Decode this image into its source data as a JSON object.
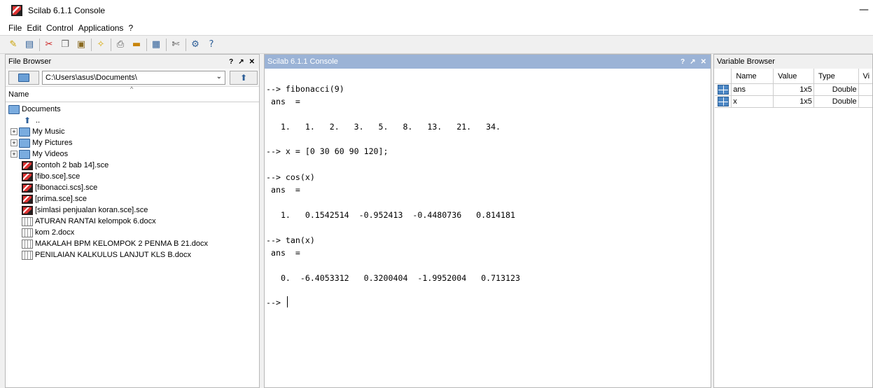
{
  "window": {
    "title": "Scilab 6.1.1 Console"
  },
  "menu": [
    "File",
    "Edit",
    "Control",
    "Applications",
    "?"
  ],
  "file_browser": {
    "title": "File Browser",
    "path": "C:\\Users\\asus\\Documents\\",
    "column_name": "Name",
    "root": "Documents",
    "up": "..",
    "items": [
      {
        "label": "My Music",
        "type": "folder"
      },
      {
        "label": "My Pictures",
        "type": "folder"
      },
      {
        "label": "My Videos",
        "type": "folder"
      },
      {
        "label": "[contoh 2 bab 14].sce",
        "type": "sce"
      },
      {
        "label": "[fibo.sce].sce",
        "type": "sce"
      },
      {
        "label": "[fibonacci.scs].sce",
        "type": "sce"
      },
      {
        "label": "[prima.sce].sce",
        "type": "sce"
      },
      {
        "label": "[simlasi penjualan koran.sce].sce",
        "type": "sce"
      },
      {
        "label": "ATURAN RANTAI kelompok 6.docx",
        "type": "doc"
      },
      {
        "label": "kom 2.docx",
        "type": "doc"
      },
      {
        "label": "MAKALAH BPM KELOMPOK 2 PENMA B 21.docx",
        "type": "doc"
      },
      {
        "label": "PENILAIAN KALKULUS LANJUT KLS B.docx",
        "type": "doc"
      }
    ]
  },
  "console": {
    "title": "Scilab 6.1.1 Console",
    "lines": [
      "--> fibonacci(9)",
      " ans  =",
      "   1.   1.   2.   3.   5.   8.   13.   21.   34.",
      "--> x = [0 30 60 90 120];",
      "--> cos(x)",
      " ans  =",
      "   1.   0.1542514  -0.952413  -0.4480736   0.814181",
      "--> tan(x)",
      " ans  =",
      "   0.  -6.4053312   0.3200404  -1.9952004   0.713123",
      "-->"
    ]
  },
  "variable_browser": {
    "title": "Variable Browser",
    "columns": [
      "Name",
      "Value",
      "Type",
      "Vi"
    ],
    "rows": [
      {
        "name": "ans",
        "value": "1x5",
        "type": "Double"
      },
      {
        "name": "x",
        "value": "1x5",
        "type": "Double"
      }
    ]
  },
  "panel_buttons": [
    "?",
    "↗",
    "✕"
  ]
}
